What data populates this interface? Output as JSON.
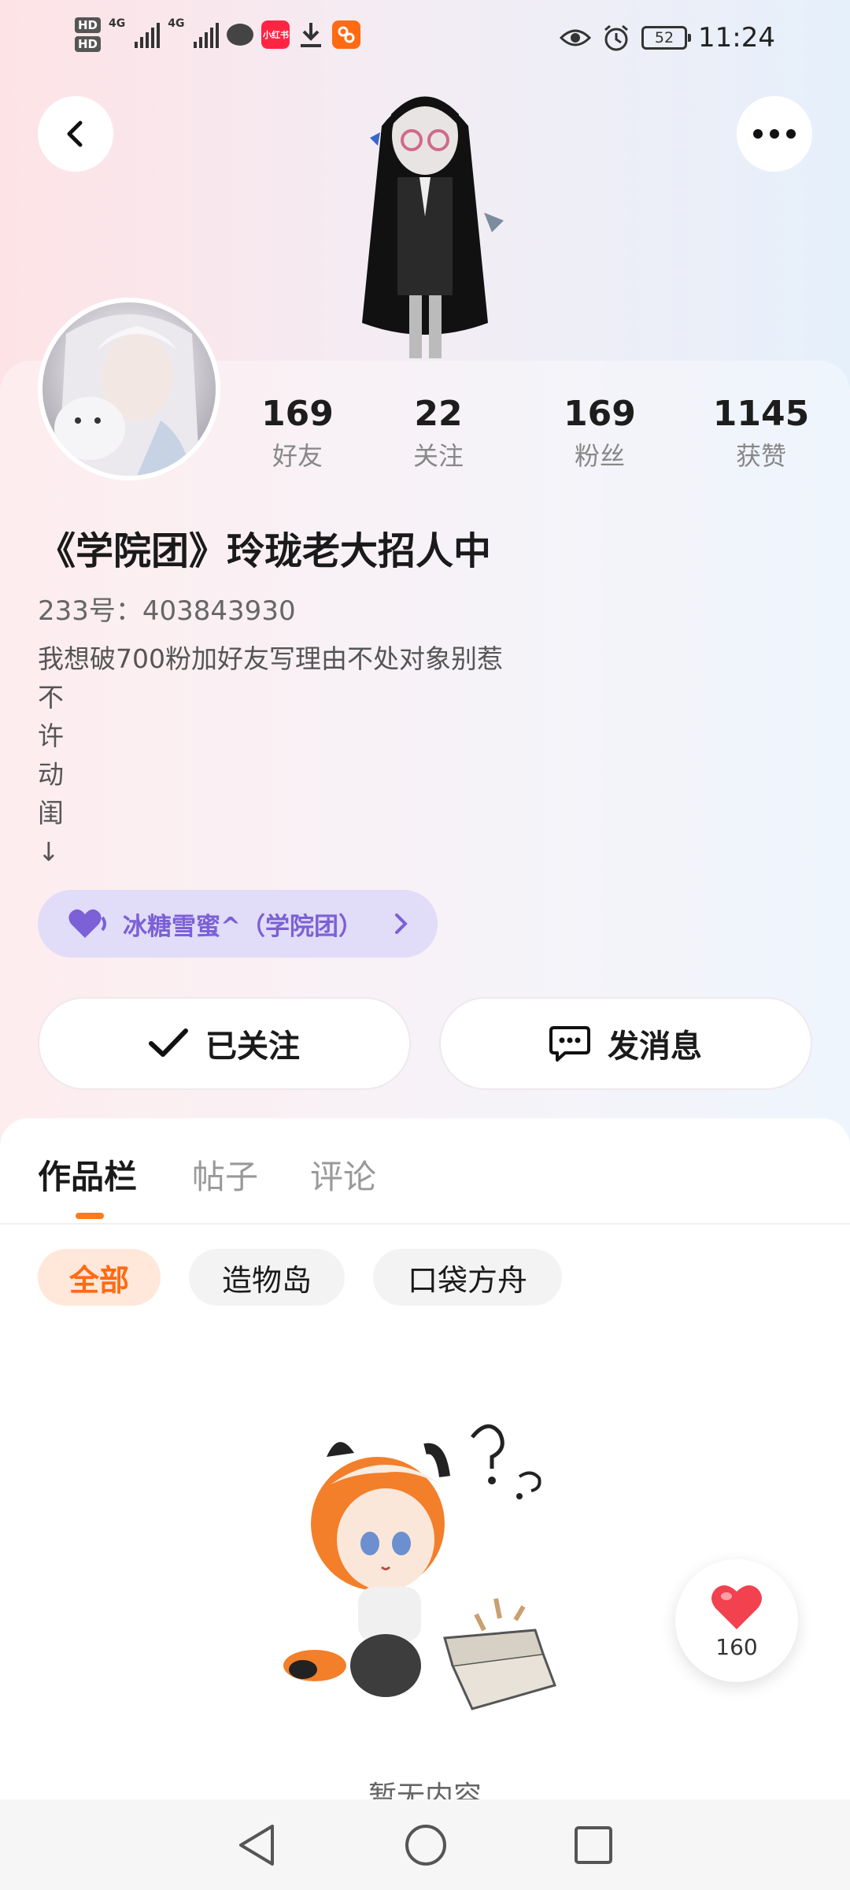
{
  "status_bar": {
    "hd1": "HD",
    "hd2": "HD",
    "net1": "4G",
    "net2": "4G",
    "app_xhs": "小红书",
    "battery": "52",
    "time": "11:24"
  },
  "profile": {
    "stats": [
      {
        "value": "169",
        "label": "好友"
      },
      {
        "value": "22",
        "label": "关注"
      },
      {
        "value": "169",
        "label": "粉丝"
      },
      {
        "value": "1145",
        "label": "获赞"
      }
    ],
    "username": "《学院团》玲珑老大招人中",
    "uid": "233号：403843930",
    "bio_lines": [
      "我想破700粉加好友写理由不处对象别惹",
      "不",
      "许",
      "动",
      "闺",
      "↓"
    ],
    "group_name": "冰糖雪蜜^（学院团）"
  },
  "actions": {
    "follow_label": "已关注",
    "message_label": "发消息"
  },
  "tabs": [
    "作品栏",
    "帖子",
    "评论"
  ],
  "filters": [
    "全部",
    "造物岛",
    "口袋方舟"
  ],
  "empty_text": "暂无内容",
  "like_count": "160",
  "colors": {
    "accent": "#ff7a1a",
    "chip_active_bg": "#ffe7d9",
    "group_pill_bg": "#e1dcf7",
    "group_text": "#7b60d6",
    "like_heart": "#f2414f"
  }
}
